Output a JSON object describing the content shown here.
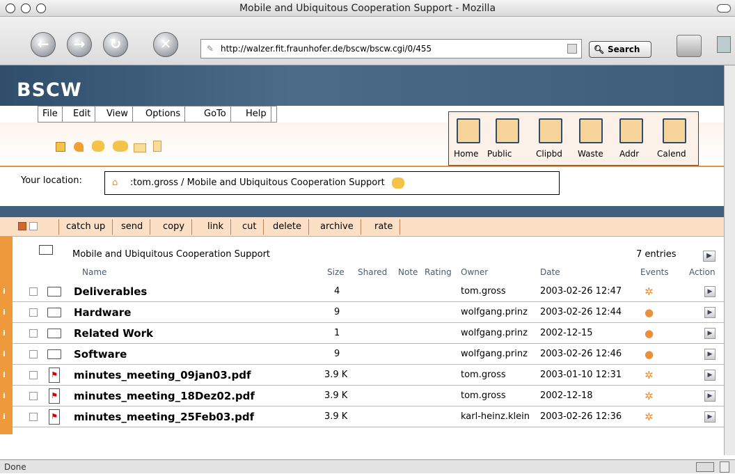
{
  "window": {
    "title": "Mobile and Ubiquitous Cooperation Support - Mozilla"
  },
  "browser": {
    "url": "http://walzer.fit.fraunhofer.de/bscw/bscw.cgi/0/455",
    "search_label": "Search",
    "status": "Done"
  },
  "bscw": {
    "logo": "BSCW",
    "menu": [
      "File",
      "Edit",
      "View",
      "Options",
      "GoTo",
      "Help"
    ],
    "panel": [
      "Home",
      "Public",
      "Clipbd",
      "Waste",
      "Addr",
      "Calend"
    ],
    "location_label": "Your location:",
    "location_path": ":tom.gross / Mobile and Ubiquitous Cooperation Support",
    "actions": [
      "catch up",
      "send",
      "copy",
      "link",
      "cut",
      "delete",
      "archive",
      "rate"
    ],
    "folder_title": "Mobile and Ubiquitous Cooperation Support",
    "entries": "7 entries",
    "columns": {
      "name": "Name",
      "size": "Size",
      "shared": "Shared",
      "note": "Note",
      "rating": "Rating",
      "owner": "Owner",
      "date": "Date",
      "events": "Events",
      "action": "Action"
    },
    "rows": [
      {
        "type": "folder",
        "name": "Deliverables",
        "size": "4",
        "owner": "tom.gross",
        "date": "2003-02-26 12:47",
        "event": "star"
      },
      {
        "type": "folder",
        "name": "Hardware",
        "size": "9",
        "owner": "wolfgang.prinz",
        "date": "2003-02-26 12:44",
        "event": "dots"
      },
      {
        "type": "folder",
        "name": "Related Work",
        "size": "1",
        "owner": "wolfgang.prinz",
        "date": "2002-12-15",
        "event": "dots"
      },
      {
        "type": "folder",
        "name": "Software",
        "size": "9",
        "owner": "wolfgang.prinz",
        "date": "2003-02-26 12:46",
        "event": "dots"
      },
      {
        "type": "pdf",
        "name": "minutes_meeting_09jan03.pdf",
        "size": "3.9 K",
        "owner": "tom.gross",
        "date": "2003-01-10 12:31",
        "event": "star"
      },
      {
        "type": "pdf",
        "name": "minutes_meeting_18Dez02.pdf",
        "size": "3.9 K",
        "owner": "tom.gross",
        "date": "2002-12-18",
        "event": "star"
      },
      {
        "type": "pdf",
        "name": "minutes_meeting_25Feb03.pdf",
        "size": "3.9 K",
        "owner": "karl-heinz.klein",
        "date": "2003-02-26 12:36",
        "event": "star"
      }
    ]
  },
  "colors": {
    "accent": "#ee9a3c",
    "header_blue": "#3f5f7d"
  }
}
